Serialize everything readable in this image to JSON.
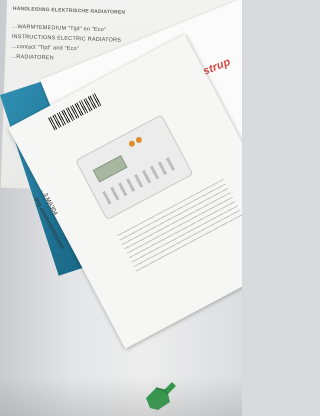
{
  "image": {
    "instruction_lines": [
      "HANDLEIDING ELEKTRISCHE RADIATOREN",
      "...WARMTEMEDIUM \"Tijd\" en \"Eco\"",
      "INSTRUCTIONS ELECTRIC RADIATORS",
      "...contact \"Tijd\" and \"Eco\"",
      "...RADIATOREN"
    ],
    "brand_logo": "kamstrup",
    "percent_badge": "%",
    "leaflet_title": "...ling elektriciteitsmeter",
    "leaflet_model": "...3 MA304",
    "colors": {
      "brand_red": "#d8443f",
      "blue": "#2d87ad",
      "green_clip": "#2f9a49"
    }
  }
}
